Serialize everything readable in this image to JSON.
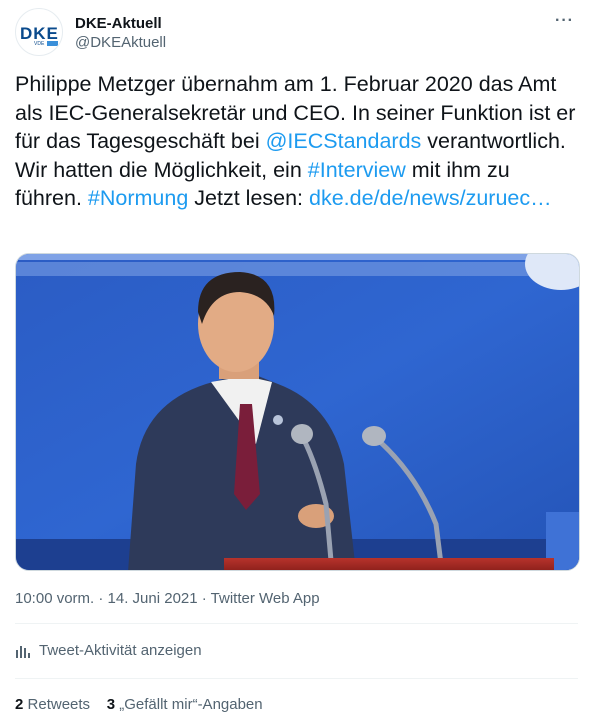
{
  "author": {
    "name": "DKE-Aktuell",
    "handle": "@DKEAktuell",
    "avatar_logo": "DKE",
    "avatar_sub": "VDE"
  },
  "tweet": {
    "text_1": "Philippe Metzger übernahm am 1. Februar 2020 das Amt als IEC-Generalsekretär und CEO. In seiner Funktion ist er für das Tagesgeschäft bei ",
    "mention": "@IECStandards",
    "text_2": " verantwortlich. Wir hatten die Möglichkeit, ein ",
    "hashtag_1": "#Interview",
    "text_3": " mit ihm zu führen. ",
    "hashtag_2": "#Normung",
    "text_4": " Jetzt lesen: ",
    "url": "dke.de/de/news/zuruec…"
  },
  "meta": "10:00 vorm. · 14. Juni 2021 · Twitter Web App",
  "activity_label": "Tweet-Aktivität anzeigen",
  "stats": {
    "retweets_count": "2",
    "retweets_label": "Retweets",
    "likes_count": "3",
    "likes_label": "„Gefällt mir“-Angaben"
  },
  "icons": {
    "more": "more-icon",
    "activity": "bar-chart-icon"
  }
}
